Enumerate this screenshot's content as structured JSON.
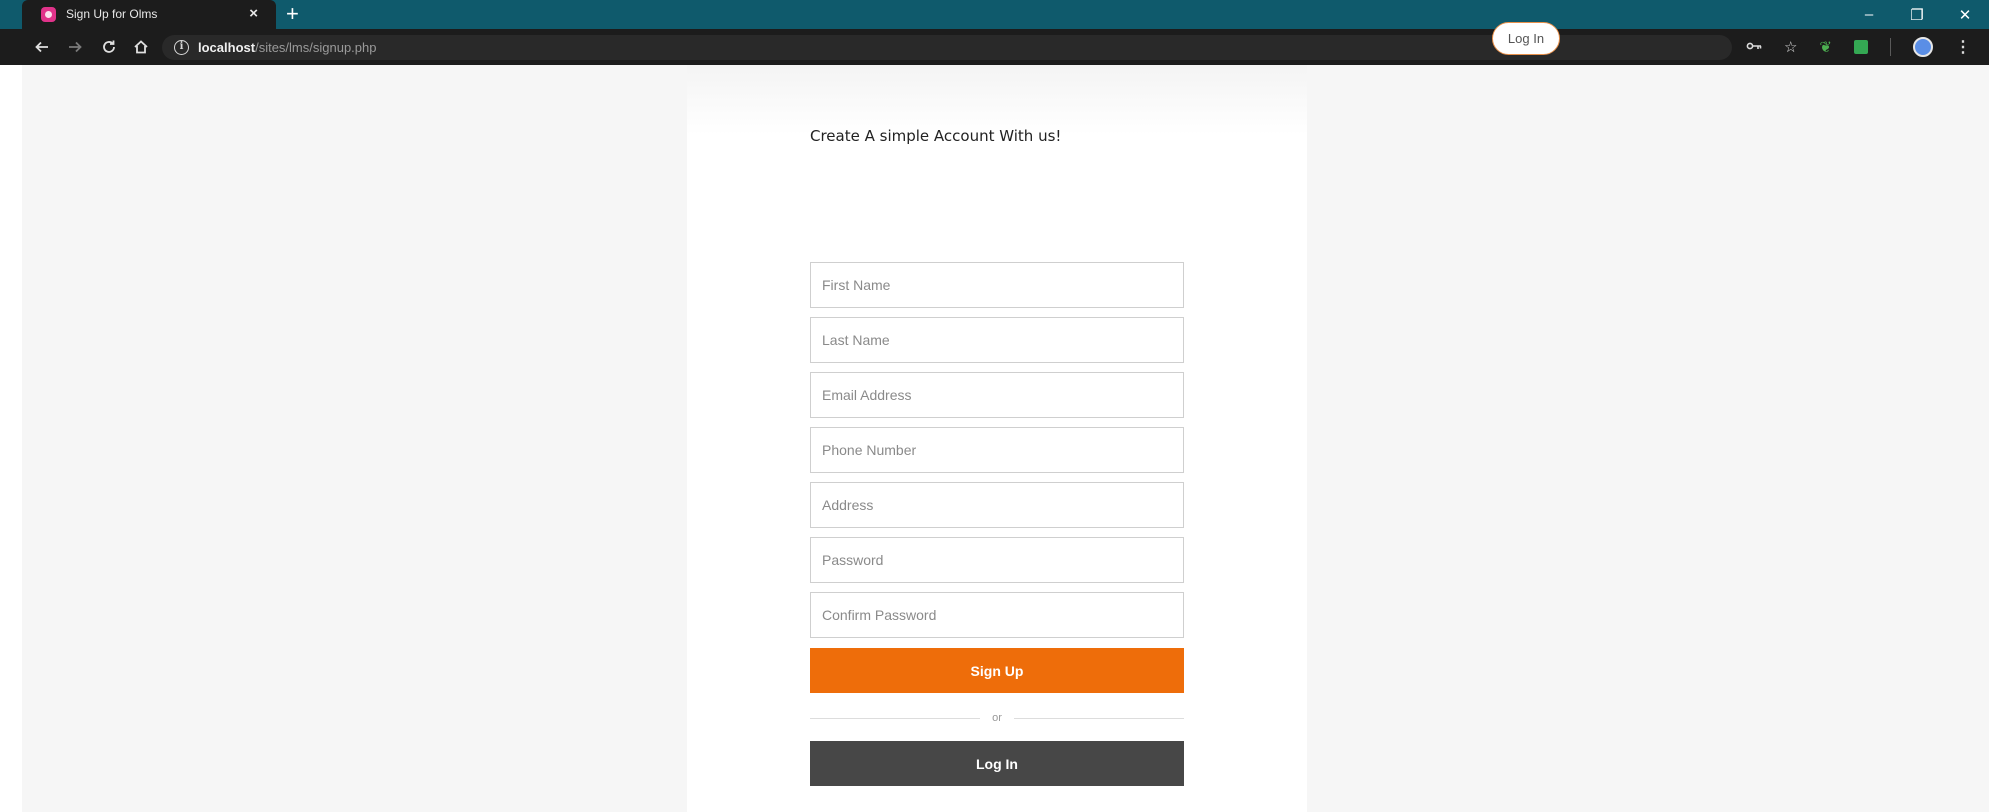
{
  "browser": {
    "tab_title": "Sign Up for Olms",
    "tab_close": "×",
    "new_tab": "+",
    "url_host": "localhost",
    "url_path": "/sites/lms/signup.php",
    "window_controls": {
      "minimize": "–",
      "restore": "❐",
      "close": "✕"
    },
    "nav_icons": [
      "back-icon",
      "forward-icon",
      "reload-icon",
      "home-icon"
    ],
    "toolbar_icons": [
      "key-icon",
      "star-icon",
      "extension-icon",
      "extension-icon",
      "profile-icon",
      "menu-icon"
    ]
  },
  "header": {
    "login_link": "Log In"
  },
  "form": {
    "heading": "Create A simple Account With us!",
    "fields": [
      {
        "name": "first-name",
        "placeholder": "First Name",
        "value": ""
      },
      {
        "name": "last-name",
        "placeholder": "Last Name",
        "value": ""
      },
      {
        "name": "email",
        "placeholder": "Email Address",
        "value": ""
      },
      {
        "name": "phone",
        "placeholder": "Phone Number",
        "value": ""
      },
      {
        "name": "address",
        "placeholder": "Address",
        "value": ""
      },
      {
        "name": "password",
        "placeholder": "Password",
        "value": ""
      },
      {
        "name": "confirm-password",
        "placeholder": "Confirm Password",
        "value": ""
      }
    ],
    "signup_button": "Sign Up",
    "divider_text": "or",
    "login_button": "Log In"
  },
  "colors": {
    "tab_strip": "#0f5a6c",
    "toolbar": "#1c1c1c",
    "signup_button": "#ee6d0a",
    "login_button": "#474747",
    "login_link_border": "#e8904a"
  }
}
